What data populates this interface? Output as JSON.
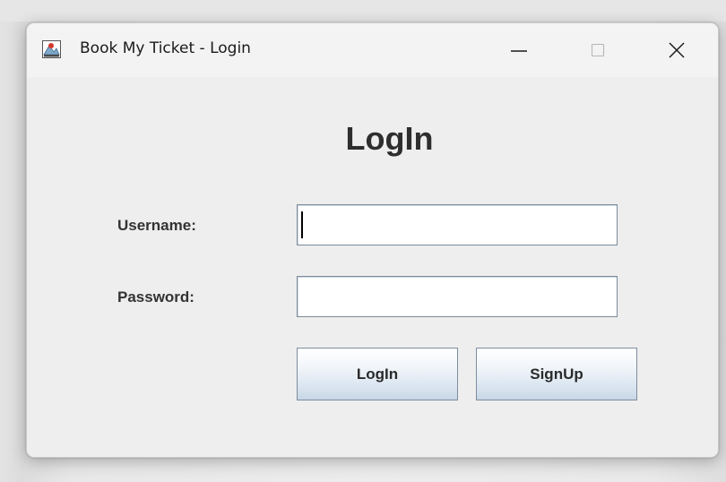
{
  "window": {
    "title": "Book My Ticket - Login",
    "icon": "app-icon",
    "controls": {
      "minimize_icon": "minimize-icon",
      "maximize_icon": "maximize-icon",
      "close_icon": "close-icon"
    }
  },
  "form": {
    "heading": "LogIn",
    "username_label": "Username:",
    "username_value": "",
    "password_label": "Password:",
    "password_value": "",
    "login_button": "LogIn",
    "signup_button": "SignUp"
  },
  "colors": {
    "window_bg": "#eeeeee",
    "titlebar_bg": "#f3f3f3",
    "button_gradient_top": "#ffffff",
    "button_gradient_bottom": "#c8d7e6",
    "input_border": "#7a8a9a"
  }
}
